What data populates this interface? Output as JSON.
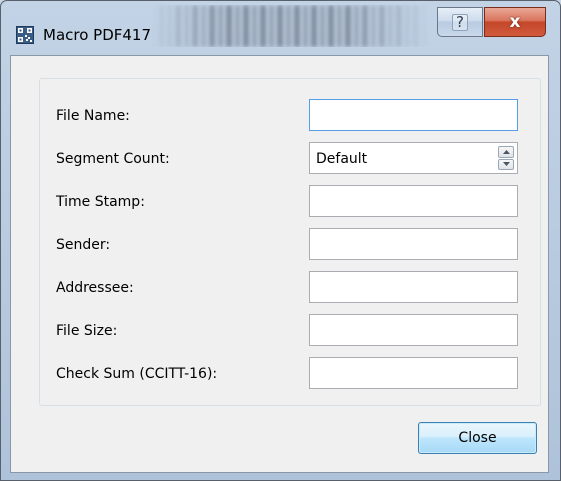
{
  "window": {
    "title": "Macro PDF417"
  },
  "caption_buttons": {
    "help": "?",
    "close": "x"
  },
  "form": {
    "file_name": {
      "label": "File Name:",
      "value": ""
    },
    "segment_count": {
      "label": "Segment Count:",
      "value": "Default"
    },
    "time_stamp": {
      "label": "Time Stamp:",
      "value": ""
    },
    "sender": {
      "label": "Sender:",
      "value": ""
    },
    "addressee": {
      "label": "Addressee:",
      "value": ""
    },
    "file_size": {
      "label": "File Size:",
      "value": ""
    },
    "check_sum": {
      "label": "Check Sum (CCITT-16):",
      "value": ""
    }
  },
  "footer": {
    "close_label": "Close"
  },
  "icons": {
    "app": "qr-code-icon",
    "help": "help-icon",
    "close": "close-icon",
    "spin_up": "chevron-up-icon",
    "spin_down": "chevron-down-icon"
  },
  "colors": {
    "focus_border": "#569de5",
    "close_caption": "#c4472a",
    "default_button": "#3c7fb1"
  }
}
